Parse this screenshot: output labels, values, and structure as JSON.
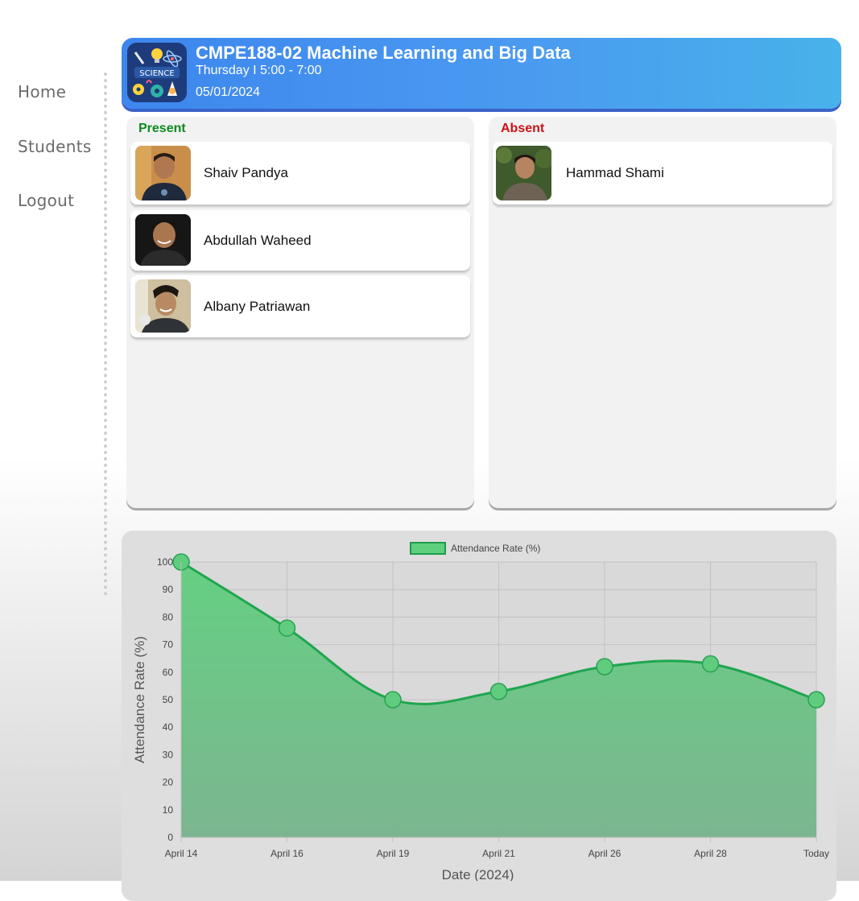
{
  "nav": {
    "items": [
      {
        "label": "Home"
      },
      {
        "label": "Students"
      },
      {
        "label": "Logout"
      }
    ]
  },
  "course": {
    "title": "CMPE188-02 Machine Learning and Big Data",
    "schedule": "Thursday I 5:00 - 7:00",
    "date": "05/01/2024",
    "logo_icon": "science-logo-icon"
  },
  "present": {
    "label": "Present",
    "color": "#0f8a1f",
    "students": [
      {
        "name": "Shaiv Pandya"
      },
      {
        "name": "Abdullah Waheed"
      },
      {
        "name": "Albany Patriawan"
      }
    ]
  },
  "absent": {
    "label": "Absent",
    "color": "#c81414",
    "students": [
      {
        "name": "Hammad Shami"
      }
    ]
  },
  "chart_data": {
    "type": "area",
    "legend": "Attendance Rate (%)",
    "legend_position": "top-center",
    "xlabel": "Date (2024)",
    "ylabel": "Attendance Rate (%)",
    "categories": [
      "April 14",
      "April 16",
      "April 19",
      "April 21",
      "April 26",
      "April 28",
      "Today"
    ],
    "series": [
      {
        "name": "Attendance Rate (%)",
        "values": [
          100,
          76,
          50,
          53,
          62,
          63,
          50
        ]
      }
    ],
    "ylim": [
      0,
      100
    ],
    "yticks": [
      0,
      10,
      20,
      30,
      40,
      50,
      60,
      70,
      80,
      90,
      100
    ],
    "grid": true,
    "line_color": "#1fa64f",
    "fill_top_color": "#5fcf7e",
    "fill_bottom_color": "#77b48c"
  }
}
